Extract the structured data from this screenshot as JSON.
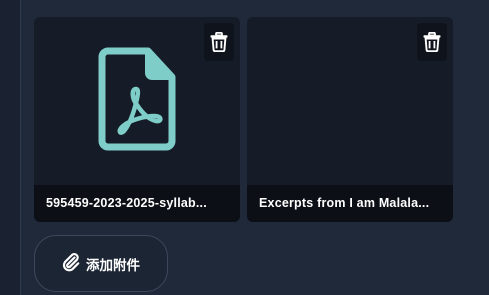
{
  "attachments": [
    {
      "filename": "595459-2023-2025-syllab...",
      "icon": "pdf-file-icon",
      "delete_icon": "trash-icon"
    },
    {
      "filename": "Excerpts from I am Malala...",
      "icon": "",
      "delete_icon": "trash-icon"
    }
  ],
  "add_attachment": {
    "label": "添加附件",
    "icon": "paperclip-icon"
  },
  "colors": {
    "pdf_icon": "#7ecdc8",
    "background": "#1f2939",
    "card": "#161c27",
    "caption_bg": "#0c1016"
  }
}
